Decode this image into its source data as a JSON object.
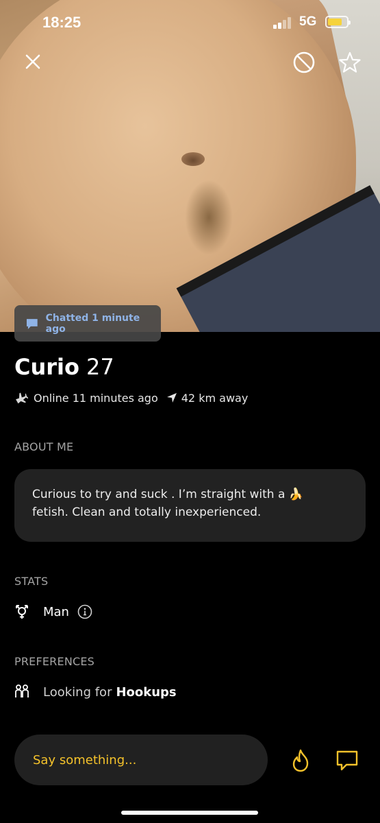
{
  "status_bar": {
    "time": "18:25",
    "network": "5G",
    "battery_level": 0.75
  },
  "colors": {
    "accent": "#F4C22B",
    "chatted_text": "#8FB3E6",
    "card_bg": "#222222",
    "section_title": "#A4A4A4"
  },
  "photo_actions": {
    "close_icon": "close-icon",
    "block_icon": "block-icon",
    "favorite_icon": "star-icon"
  },
  "chatted_badge": {
    "icon": "chat-bubble-icon",
    "text": "Chatted 1 minute ago"
  },
  "profile": {
    "name": "Curio",
    "age": "27",
    "online_status": "Online 11 minutes ago",
    "distance": "42 km away"
  },
  "about": {
    "title": "ABOUT ME",
    "line1": "Curious to try and suck . I’m straight with a 🍌",
    "line2": "fetish. Clean and totally inexperienced."
  },
  "stats": {
    "title": "STATS",
    "gender": "Man",
    "icon": "gender-icon",
    "info_icon": "info-icon"
  },
  "preferences": {
    "title": "PREFERENCES",
    "looking_for_prefix": "Looking for",
    "looking_for_value": "Hookups",
    "icon": "people-icon"
  },
  "chat": {
    "placeholder": "Say something...",
    "tap_icon": "flame-icon",
    "message_icon": "message-icon"
  }
}
